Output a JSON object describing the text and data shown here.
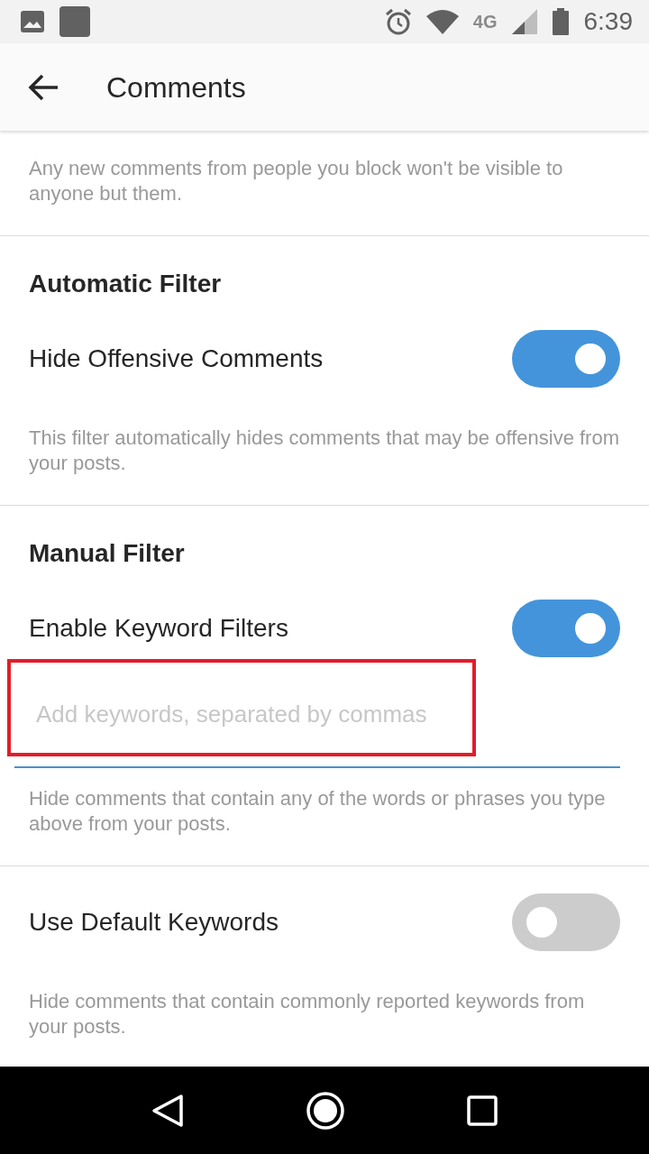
{
  "status_bar": {
    "network": "4G",
    "time": "6:39"
  },
  "header": {
    "title": "Comments"
  },
  "sections": [
    {
      "kind": "note",
      "text": "Any new comments from people you block won't be visible to anyone but them."
    },
    {
      "kind": "heading",
      "text": "Automatic Filter"
    },
    {
      "kind": "toggle",
      "label": "Hide Offensive Comments",
      "on": true
    },
    {
      "kind": "note",
      "text": "This filter automatically hides comments that may be offensive from your posts."
    },
    {
      "kind": "heading",
      "text": "Manual Filter"
    },
    {
      "kind": "toggle",
      "label": "Enable Keyword Filters",
      "on": true
    },
    {
      "kind": "input",
      "placeholder": "Add keywords, separated by commas",
      "highlighted": true
    },
    {
      "kind": "note",
      "text": "Hide comments that contain any of the words or phrases you type above from your posts."
    },
    {
      "kind": "toggle",
      "label": "Use Default Keywords",
      "on": false
    },
    {
      "kind": "note",
      "text": "Hide comments that contain commonly reported keywords from your posts."
    }
  ]
}
